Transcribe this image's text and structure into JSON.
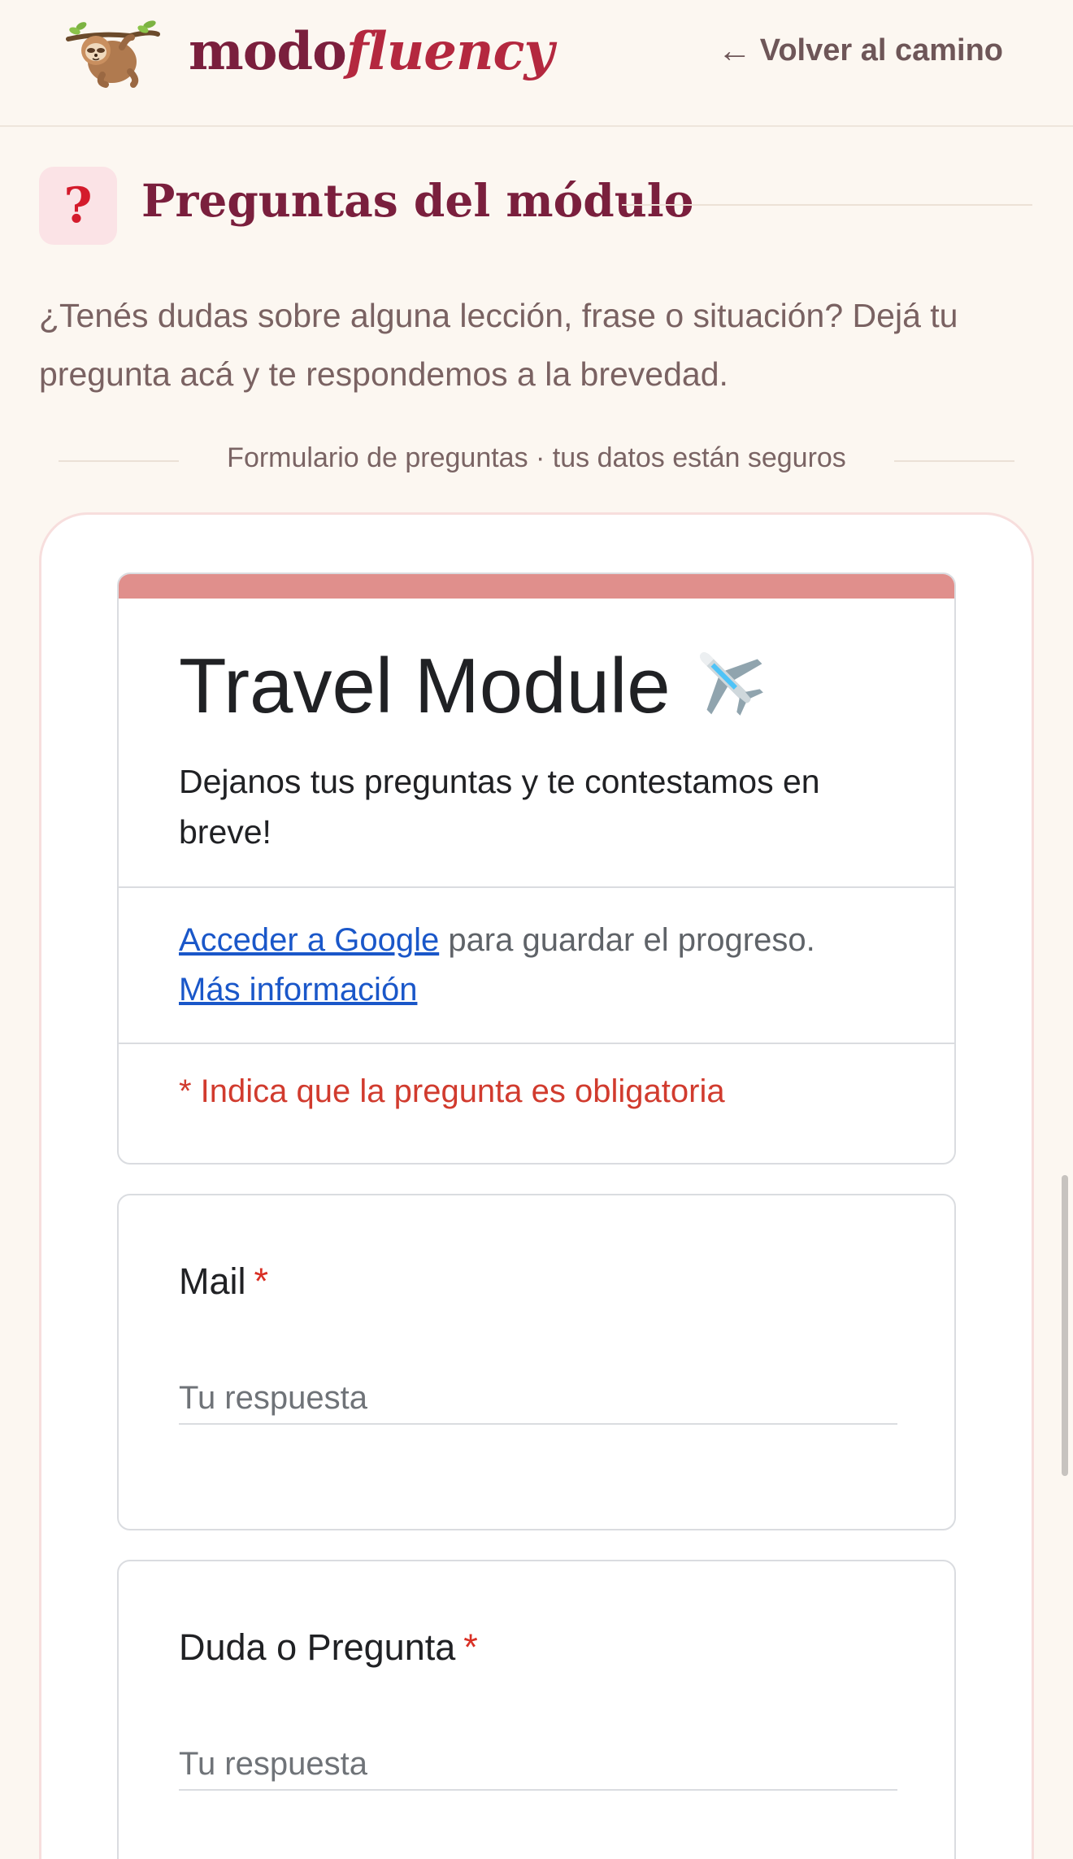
{
  "header": {
    "brand_part1": "modo",
    "brand_part2": "fluency",
    "back_arrow": "←",
    "back_label": "Volver al camino",
    "logo_icon": "sloth-icon"
  },
  "section": {
    "icon_glyph": "?",
    "title": "Preguntas del módulo",
    "intro": "¿Tenés dudas sobre alguna lección, frase o situación? Dejá tu pregunta acá y te respondemos a la brevedad."
  },
  "divider": {
    "label": "Formulario de preguntas · tus datos están seguros"
  },
  "form": {
    "title": "Travel Module",
    "title_icon": "airplane-icon",
    "description": "Dejanos tus preguntas y te contestamos en breve!",
    "signin_link": "Acceder a Google",
    "signin_text": " para guardar el progreso.",
    "more_info_link": "Más información",
    "required_note": "* Indica que la pregunta es obligatoria",
    "accent_color": "#e08f8c",
    "questions": [
      {
        "label": "Mail",
        "required_mark": "*",
        "placeholder": "Tu respuesta"
      },
      {
        "label": "Duda o Pregunta",
        "required_mark": "*",
        "placeholder": "Tu respuesta"
      }
    ]
  },
  "colors": {
    "brand": "#7a1f3d",
    "brand_accent": "#b4283f",
    "page_bg": "#fcf7f1",
    "required": "#d93025",
    "link": "#1a57c9"
  }
}
